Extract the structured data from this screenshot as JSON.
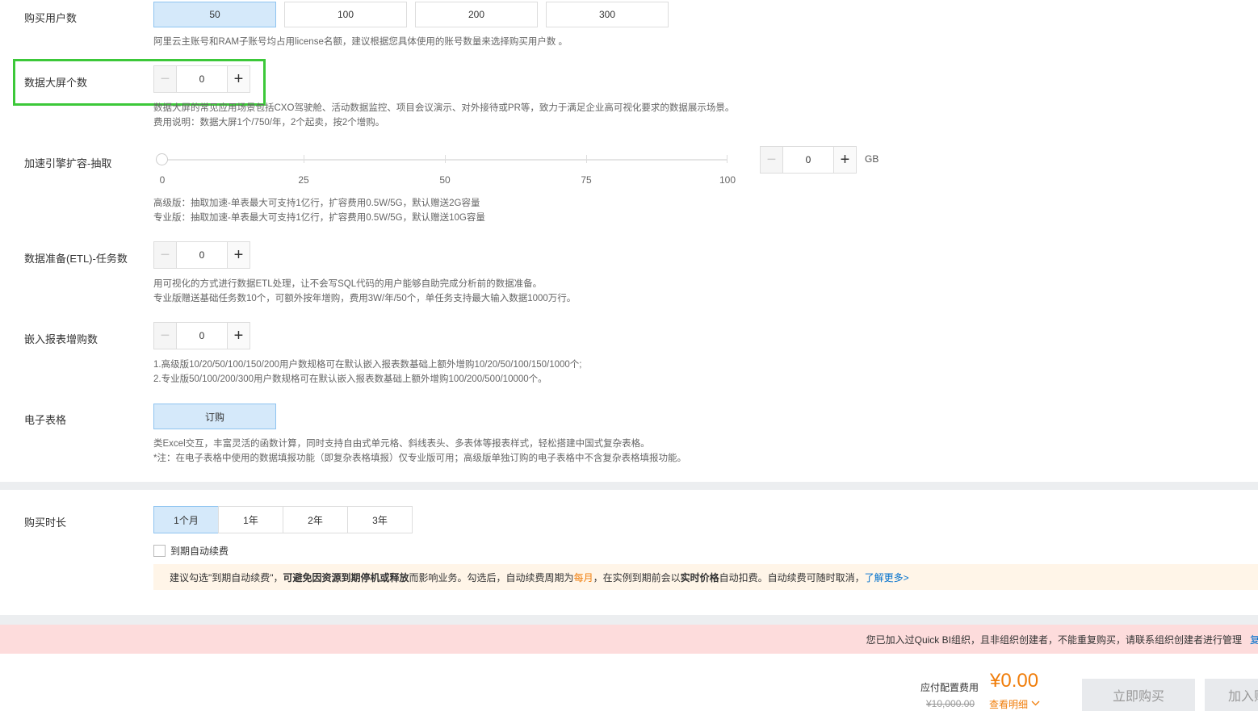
{
  "users": {
    "label": "购买用户数",
    "options": [
      "50",
      "100",
      "200",
      "300"
    ],
    "selected": "50",
    "desc": "阿里云主账号和RAM子账号均占用license名额，建议根据您具体使用的账号数量来选择购买用户数 。"
  },
  "screens": {
    "label": "数据大屏个数",
    "value": "0",
    "desc1": "数据大屏的常见应用场景包括CXO驾驶舱、活动数据监控、项目会议演示、对外接待或PR等，致力于满足企业高可视化要求的数据展示场景。",
    "desc2": "费用说明：数据大屏1个/750/年，2个起卖，按2个增购。"
  },
  "engine": {
    "label": "加速引擎扩容-抽取",
    "slider_value": 0,
    "slider_marks": [
      "0",
      "25",
      "50",
      "75",
      "100"
    ],
    "value": "0",
    "unit": "GB",
    "desc1": "高级版：抽取加速-单表最大可支持1亿行，扩容费用0.5W/5G，默认赠送2G容量",
    "desc2": "专业版：抽取加速-单表最大可支持1亿行，扩容费用0.5W/5G，默认赠送10G容量"
  },
  "etl": {
    "label": "数据准备(ETL)-任务数",
    "value": "0",
    "desc1": "用可视化的方式进行数据ETL处理，让不会写SQL代码的用户能够自助完成分析前的数据准备。",
    "desc2": "专业版赠送基础任务数10个，可额外按年增购，费用3W/年/50个，单任务支持最大输入数据1000万行。"
  },
  "embed": {
    "label": "嵌入报表增购数",
    "value": "0",
    "desc1": "1.高级版10/20/50/100/150/200用户数规格可在默认嵌入报表数基础上额外增购10/20/50/100/150/1000个;",
    "desc2": "2.专业版50/100/200/300用户数规格可在默认嵌入报表数基础上额外增购100/200/500/10000个。"
  },
  "sheet": {
    "label": "电子表格",
    "button": "订购",
    "desc1": "类Excel交互，丰富灵活的函数计算，同时支持自由式单元格、斜线表头、多表体等报表样式，轻松搭建中国式复杂表格。",
    "desc2": "*注：在电子表格中使用的数据填报功能（即复杂表格填报）仅专业版可用；高级版单独订购的电子表格中不含复杂表格填报功能。"
  },
  "duration": {
    "label": "购买时长",
    "options": [
      "1个月",
      "1年",
      "2年",
      "3年"
    ],
    "selected": "1个月",
    "auto_renew": "到期自动续费"
  },
  "notice": {
    "p1": "建议勾选\"到期自动续费\"，",
    "p2": "可避免因资源到期停机或释放",
    "p3": "而影响业务。勾选后，自动续费周期为 ",
    "p4": "每月",
    "p5": "，在实例到期前会以",
    "p6": "实时价格",
    "p7": "自动扣费。自动续费可随时取消，",
    "link": "了解更多>"
  },
  "error": {
    "text": "您已加入过Quick BI组织，且非组织创建者，不能重复购买，请联系组织创建者进行管理",
    "link": "复"
  },
  "footer": {
    "fee_label": "应付配置费用",
    "price": "¥0.00",
    "original": "¥10,000.00",
    "detail": "查看明细",
    "buy": "立即购买",
    "cart": "加入购物车"
  },
  "colors": {
    "selected_bg": "#d5e9fa",
    "accent_orange": "#f07d0a",
    "link_blue": "#0070cc",
    "highlight_green": "#3cc839",
    "error_bg": "#fddcdc"
  }
}
